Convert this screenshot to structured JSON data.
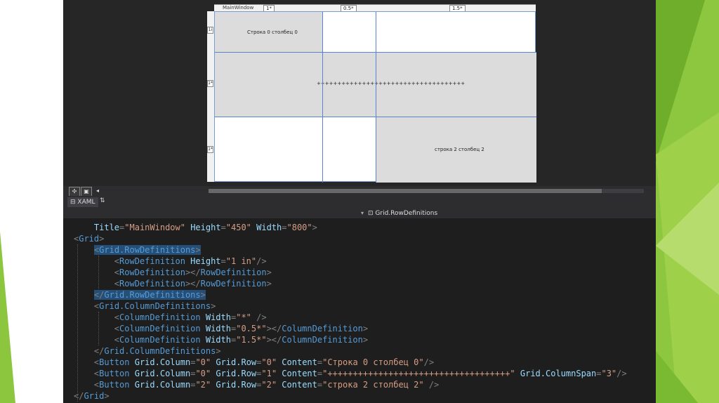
{
  "designer": {
    "window_title": "MainWindow",
    "column_width_labels": [
      "1*",
      "0.5*",
      "1.5*"
    ],
    "row_height_labels": [
      "1i",
      "1*",
      "1*"
    ],
    "cells": {
      "r0c0": "Строка 0 столбец 0",
      "r1span": "++++++++++++++++++++++++++++++++++++",
      "r2c2": "строка 2 столбец 2"
    }
  },
  "toolbar": {
    "xaml_tab_label": "XAML"
  },
  "navbar": {
    "breadcrumb": "Grid.RowDefinitions"
  },
  "code_lines": [
    {
      "indent": "    ",
      "tokens": [
        {
          "t": "Title",
          "c": "a"
        },
        {
          "t": "=",
          "c": "p"
        },
        {
          "t": "\"MainWindow\"",
          "c": "s"
        },
        {
          "t": " Height",
          "c": "a"
        },
        {
          "t": "=",
          "c": "p"
        },
        {
          "t": "\"450\"",
          "c": "s"
        },
        {
          "t": " Width",
          "c": "a"
        },
        {
          "t": "=",
          "c": "p"
        },
        {
          "t": "\"800\"",
          "c": "s"
        },
        {
          "t": ">",
          "c": "p"
        }
      ]
    },
    {
      "indent": "",
      "tokens": [
        {
          "t": "<",
          "c": "p"
        },
        {
          "t": "Grid",
          "c": "t"
        },
        {
          "t": ">",
          "c": "p"
        }
      ]
    },
    {
      "indent": "    ",
      "highlight": true,
      "tokens": [
        {
          "t": "<",
          "c": "p"
        },
        {
          "t": "Grid.RowDefinitions",
          "c": "t"
        },
        {
          "t": ">",
          "c": "p"
        }
      ]
    },
    {
      "indent": "        ",
      "tokens": [
        {
          "t": "<",
          "c": "p"
        },
        {
          "t": "RowDefinition",
          "c": "t"
        },
        {
          "t": " Height",
          "c": "a"
        },
        {
          "t": "=",
          "c": "p"
        },
        {
          "t": "\"1 in\"",
          "c": "s"
        },
        {
          "t": "/>",
          "c": "p"
        }
      ]
    },
    {
      "indent": "        ",
      "tokens": [
        {
          "t": "<",
          "c": "p"
        },
        {
          "t": "RowDefinition",
          "c": "t"
        },
        {
          "t": "></",
          "c": "p"
        },
        {
          "t": "RowDefinition",
          "c": "t"
        },
        {
          "t": ">",
          "c": "p"
        }
      ]
    },
    {
      "indent": "        ",
      "tokens": [
        {
          "t": "<",
          "c": "p"
        },
        {
          "t": "RowDefinition",
          "c": "t"
        },
        {
          "t": "></",
          "c": "p"
        },
        {
          "t": "RowDefinition",
          "c": "t"
        },
        {
          "t": ">",
          "c": "p"
        }
      ]
    },
    {
      "indent": "    ",
      "highlight": true,
      "tokens": [
        {
          "t": "</",
          "c": "p"
        },
        {
          "t": "Grid.RowDefinitions",
          "c": "t"
        },
        {
          "t": ">",
          "c": "p"
        }
      ]
    },
    {
      "indent": "    ",
      "tokens": [
        {
          "t": "<",
          "c": "p"
        },
        {
          "t": "Grid.ColumnDefinitions",
          "c": "t"
        },
        {
          "t": ">",
          "c": "p"
        }
      ]
    },
    {
      "indent": "        ",
      "tokens": [
        {
          "t": "<",
          "c": "p"
        },
        {
          "t": "ColumnDefinition",
          "c": "t"
        },
        {
          "t": " Width",
          "c": "a"
        },
        {
          "t": "=",
          "c": "p"
        },
        {
          "t": "\"*\"",
          "c": "s"
        },
        {
          "t": " />",
          "c": "p"
        }
      ]
    },
    {
      "indent": "        ",
      "tokens": [
        {
          "t": "<",
          "c": "p"
        },
        {
          "t": "ColumnDefinition",
          "c": "t"
        },
        {
          "t": " Width",
          "c": "a"
        },
        {
          "t": "=",
          "c": "p"
        },
        {
          "t": "\"0.5*\"",
          "c": "s"
        },
        {
          "t": "></",
          "c": "p"
        },
        {
          "t": "ColumnDefinition",
          "c": "t"
        },
        {
          "t": ">",
          "c": "p"
        }
      ]
    },
    {
      "indent": "        ",
      "tokens": [
        {
          "t": "<",
          "c": "p"
        },
        {
          "t": "ColumnDefinition",
          "c": "t"
        },
        {
          "t": " Width",
          "c": "a"
        },
        {
          "t": "=",
          "c": "p"
        },
        {
          "t": "\"1.5*\"",
          "c": "s"
        },
        {
          "t": "></",
          "c": "p"
        },
        {
          "t": "ColumnDefinition",
          "c": "t"
        },
        {
          "t": ">",
          "c": "p"
        }
      ]
    },
    {
      "indent": "    ",
      "tokens": [
        {
          "t": "</",
          "c": "p"
        },
        {
          "t": "Grid.ColumnDefinitions",
          "c": "t"
        },
        {
          "t": ">",
          "c": "p"
        }
      ]
    },
    {
      "indent": "    ",
      "tokens": [
        {
          "t": "<",
          "c": "p"
        },
        {
          "t": "Button",
          "c": "t"
        },
        {
          "t": " Grid.Column",
          "c": "a"
        },
        {
          "t": "=",
          "c": "p"
        },
        {
          "t": "\"0\"",
          "c": "s"
        },
        {
          "t": " Grid.Row",
          "c": "a"
        },
        {
          "t": "=",
          "c": "p"
        },
        {
          "t": "\"0\"",
          "c": "s"
        },
        {
          "t": " Content",
          "c": "a"
        },
        {
          "t": "=",
          "c": "p"
        },
        {
          "t": "\"Строка 0 столбец 0\"",
          "c": "s"
        },
        {
          "t": "/>",
          "c": "p"
        }
      ]
    },
    {
      "indent": "    ",
      "tokens": [
        {
          "t": "<",
          "c": "p"
        },
        {
          "t": "Button",
          "c": "t"
        },
        {
          "t": " Grid.Column",
          "c": "a"
        },
        {
          "t": "=",
          "c": "p"
        },
        {
          "t": "\"0\"",
          "c": "s"
        },
        {
          "t": " Grid.Row",
          "c": "a"
        },
        {
          "t": "=",
          "c": "p"
        },
        {
          "t": "\"1\"",
          "c": "s"
        },
        {
          "t": " Content",
          "c": "a"
        },
        {
          "t": "=",
          "c": "p"
        },
        {
          "t": "\"++++++++++++++++++++++++++++++++++++\"",
          "c": "s"
        },
        {
          "t": " Grid.ColumnSpan",
          "c": "a"
        },
        {
          "t": "=",
          "c": "p"
        },
        {
          "t": "\"3\"",
          "c": "s"
        },
        {
          "t": "/>",
          "c": "p"
        }
      ]
    },
    {
      "indent": "    ",
      "tokens": [
        {
          "t": "<",
          "c": "p"
        },
        {
          "t": "Button",
          "c": "t"
        },
        {
          "t": " Grid.Column",
          "c": "a"
        },
        {
          "t": "=",
          "c": "p"
        },
        {
          "t": "\"2\"",
          "c": "s"
        },
        {
          "t": " Grid.Row",
          "c": "a"
        },
        {
          "t": "=",
          "c": "p"
        },
        {
          "t": "\"2\"",
          "c": "s"
        },
        {
          "t": " Content",
          "c": "a"
        },
        {
          "t": "=",
          "c": "p"
        },
        {
          "t": "\"строка 2 столбец 2\"",
          "c": "s"
        },
        {
          "t": " />",
          "c": "p"
        }
      ]
    },
    {
      "indent": "",
      "tokens": [
        {
          "t": "</",
          "c": "p"
        },
        {
          "t": "Grid",
          "c": "t"
        },
        {
          "t": ">",
          "c": "p"
        }
      ]
    }
  ]
}
